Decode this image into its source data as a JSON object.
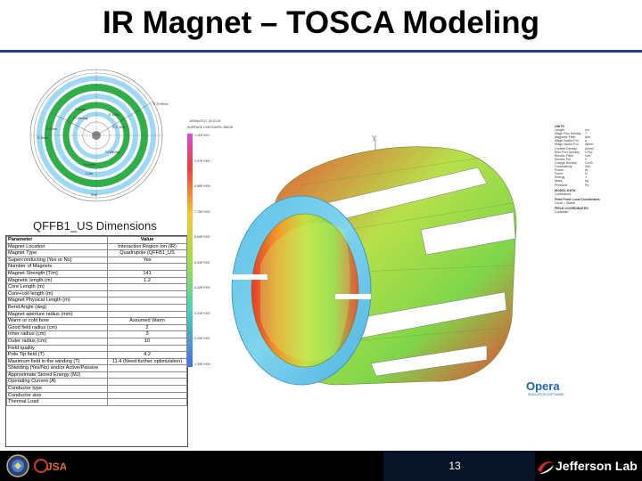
{
  "slide": {
    "title": "IR Magnet – TOSCA Modeling",
    "page_number": "13"
  },
  "table": {
    "heading": "QFFB1_US Dimensions",
    "col_param": "Parameter",
    "col_value": "Value",
    "rows": [
      {
        "p": "Magnet Location",
        "v": "Interaction Region Ion (IR)"
      },
      {
        "p": "Magnet Type",
        "v": "Quadrupole (QFFB1_US"
      },
      {
        "p": "Superconducting (Yes or No)",
        "v": "Yes"
      },
      {
        "p": "Number of Magnets",
        "v": ""
      },
      {
        "p": "Magnet Strength [T/m]",
        "v": "141"
      },
      {
        "p": "Magnetic length (m)",
        "v": "1.2"
      },
      {
        "p": "Core Length (m)",
        "v": ""
      },
      {
        "p": "Core+coil length (m)",
        "v": ""
      },
      {
        "p": "Magnet Physical Length (m)",
        "v": ""
      },
      {
        "p": "Bend Angle (deg)",
        "v": ""
      },
      {
        "p": "Magnet aperture radius (mm)",
        "v": ""
      },
      {
        "p": "Warm or cold bore",
        "v": "Assumed Warm"
      },
      {
        "p": "Good field radius (cm)",
        "v": "2"
      },
      {
        "p": "Inner radius (cm)",
        "v": "3"
      },
      {
        "p": "Outer radius (cm)",
        "v": "10"
      },
      {
        "p": "Field quality",
        "v": ""
      },
      {
        "p": "Pole Tip field (T)",
        "v": "4.2"
      },
      {
        "p": "Maximum field in the winding (T)",
        "v": "11.4 (Need further optimization)"
      },
      {
        "p": "Shielding (Yes/No) and/or Active/Passive",
        "v": ""
      },
      {
        "p": "Approximate Stored Energy (MJ)",
        "v": ""
      },
      {
        "p": "Operating Current (A)",
        "v": ""
      },
      {
        "p": "Conductor type",
        "v": ""
      },
      {
        "p": "Conductor size",
        "v": ""
      },
      {
        "p": "Thermal Load",
        "v": ""
      }
    ]
  },
  "scale": {
    "date": "16/Sep/2017 15:22:29",
    "quantity": "SURFACE CONTOURS: BMOD",
    "labels": [
      "1.11E+001",
      "9.97E+000",
      "8.86E+000",
      "7.75E+000",
      "6.64E+000",
      "5.53E+000",
      "4.42E+000",
      "3.31E+000",
      "2.20E+000",
      "1.09E+000"
    ]
  },
  "info": {
    "units_header": "UNITS",
    "units": [
      [
        "Length",
        "cm"
      ],
      [
        "Magn Flux Density",
        "T"
      ],
      [
        "Magnetic Field",
        "A/m"
      ],
      [
        "Magn Scalar Pot",
        "A"
      ],
      [
        "Magn Vector Pot",
        "Wb/m"
      ],
      [
        "Current Density",
        "A/cm2"
      ],
      [
        "Elec Flux Density",
        "C/m2"
      ],
      [
        "Electric Field",
        "V/m"
      ],
      [
        "Electric Pot",
        "V"
      ],
      [
        "Charge Density",
        "C/m3"
      ],
      [
        "Conductivity",
        "S/m"
      ],
      [
        "Power",
        "W"
      ],
      [
        "Force",
        "N"
      ],
      [
        "Energy",
        "J"
      ],
      [
        "Mass",
        "kg"
      ],
      [
        "Pressure",
        "Pa"
      ]
    ],
    "model_header": "MODEL DATA",
    "model_value": "Conductors",
    "field_header": "Field Point Local Coordinates",
    "field_value": "Local = Global",
    "field_coords_header": "FIELD COORDINATES",
    "field_coords": "Cartesian"
  },
  "xsection": {
    "labels": [
      "P1 Winding",
      "P2 Winding",
      "R 20.99mm",
      "R 27.5mm",
      "R 38mm",
      "R 45mm",
      "R 56mm",
      "R 63mm",
      "Iron yoke",
      "Collar",
      "Shell"
    ]
  },
  "footer": {
    "lab_name": "Jefferson Lab",
    "jsa_text": "JSA",
    "opera_logo": "Opera",
    "opera_sub": "SIMULATION SOFTWARE"
  },
  "colors": {
    "title_rule": "#1f3f86",
    "footer_bg": "#000000",
    "magnet_field_high": "#e63b2a",
    "magnet_field_mid": "#8ad94a",
    "magnet_field_low": "#5fc1e8"
  }
}
